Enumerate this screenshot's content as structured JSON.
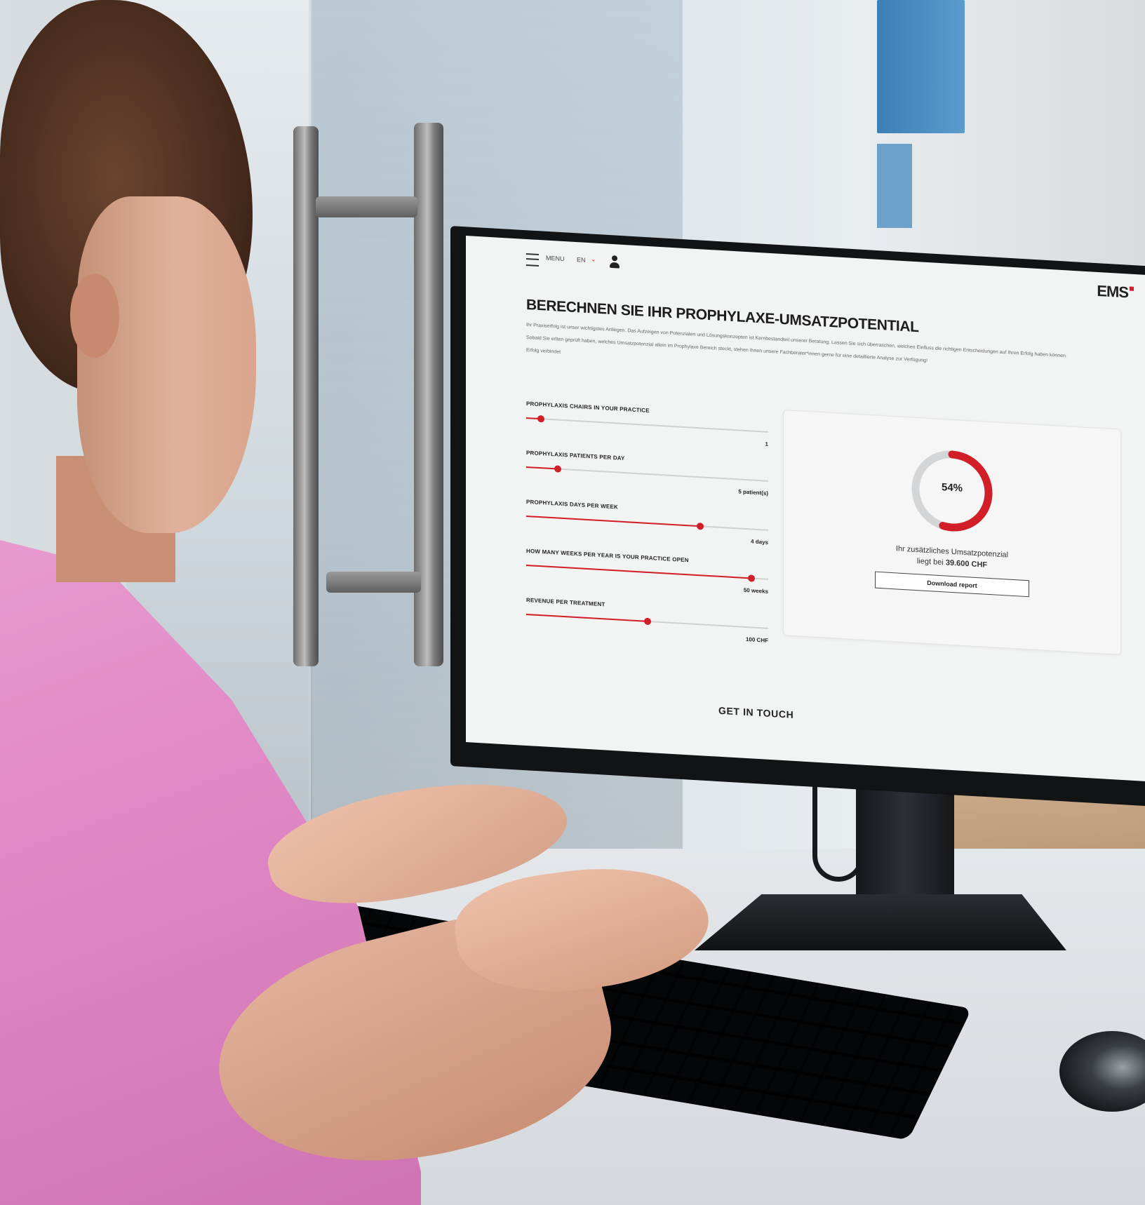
{
  "nav": {
    "menu_label": "MENU",
    "language": "EN",
    "brand": "EMS"
  },
  "page": {
    "title": "BERECHNEN SIE IHR PROPHYLAXE-UMSATZPOTENTIAL",
    "intro_1": "Ihr Praxiserfolg ist unser wichtigstes Anliegen. Das Aufzeigen von Potenzialen und Lösungskonzepten ist Kernbestandteil unserer Beratung. Lassen Sie sich überraschen, welchen Einfluss die richtigen Entscheidungen auf Ihren Erfolg haben können.",
    "intro_2": "Sobald Sie erlten geprüft haben, welches Umsatzpotenzial allein im Prophylaxe Bereich steckt, stehen Ihnen unsere Fachberater*innen gerne für eine detaillierte Analyse zur Verfügung!",
    "intro_3": "Erfolg verbindet"
  },
  "sliders": [
    {
      "label": "PROPHYLAXIS CHAIRS IN YOUR PRACTICE",
      "value_text": "1",
      "fraction": 0.06
    },
    {
      "label": "PROPHYLAXIS PATIENTS PER DAY",
      "value_text": "5 patient(s)",
      "fraction": 0.13
    },
    {
      "label": "PROPHYLAXIS DAYS PER WEEK",
      "value_text": "4 days",
      "fraction": 0.72
    },
    {
      "label": "HOW MANY WEEKS PER YEAR IS YOUR PRACTICE OPEN",
      "value_text": "50 weeks",
      "fraction": 0.93
    },
    {
      "label": "REVENUE PER TREATMENT",
      "value_text": "100 CHF",
      "fraction": 0.5
    }
  ],
  "result": {
    "percent_text": "54%",
    "percent_value": 54,
    "line1": "Ihr zusätzliches Umsatzpotenzial",
    "line2_prefix": "liegt bei",
    "line2_amount": "39.600 CHF",
    "download_label": "Download report"
  },
  "footer": {
    "get_in_touch": "GET IN TOUCH"
  },
  "colors": {
    "accent": "#d21f27",
    "track": "#cfd1d3",
    "gauge_bg": "#d3d5d7"
  }
}
